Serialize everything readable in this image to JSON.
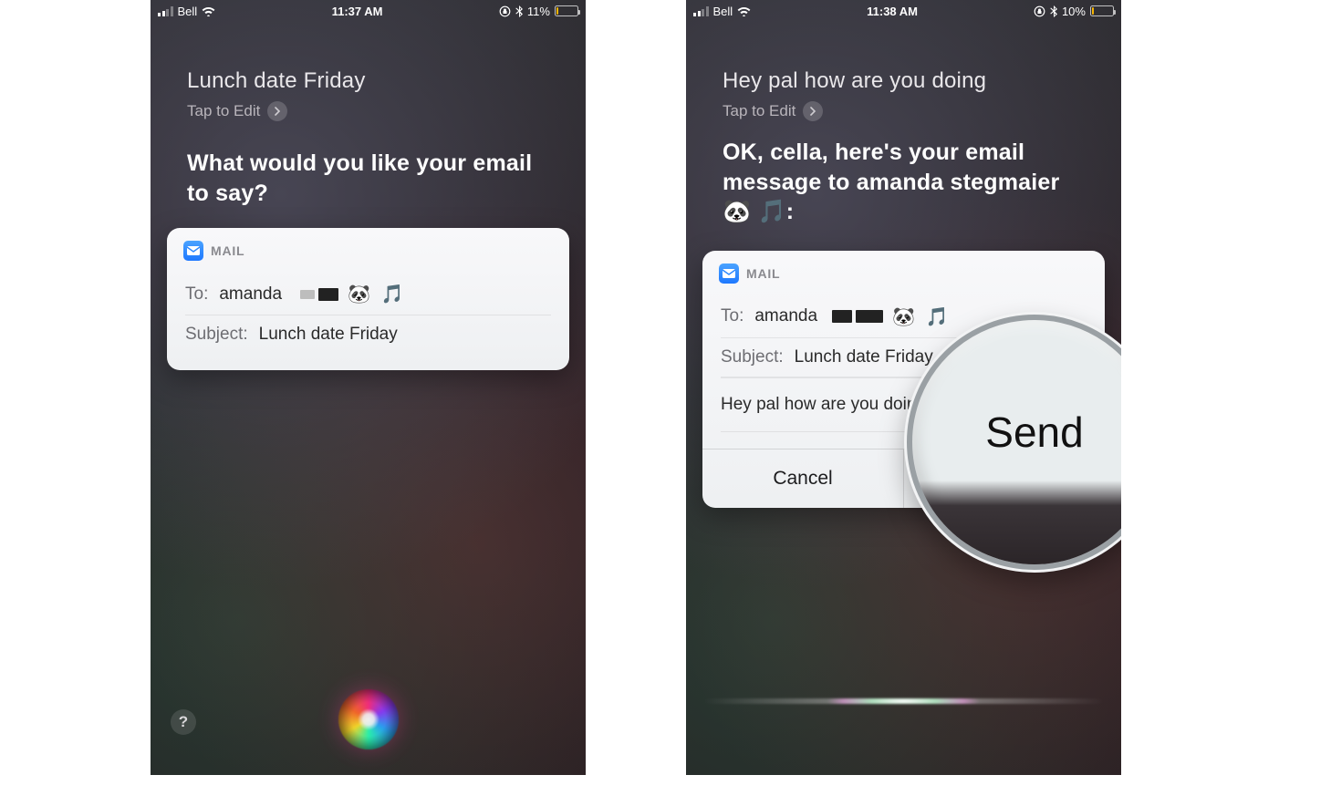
{
  "screens": [
    {
      "status": {
        "carrier": "Bell",
        "time": "11:37 AM",
        "battery_pct": "11%",
        "battery_level": 11
      },
      "user_said": "Lunch date Friday",
      "tap_edit": "Tap to Edit",
      "siri_reply": "What would you like your email to say?",
      "card": {
        "app_label": "MAIL",
        "to_label": "To:",
        "to_value": "amanda",
        "to_emoji": "🐼 🎵",
        "subject_label": "Subject:",
        "subject_value": "Lunch date Friday"
      }
    },
    {
      "status": {
        "carrier": "Bell",
        "time": "11:38 AM",
        "battery_pct": "10%",
        "battery_level": 10
      },
      "user_said": "Hey pal how are you doing",
      "tap_edit": "Tap to Edit",
      "siri_reply": "OK, cella, here's your email message to amanda stegmaier 🐼 🎵:",
      "card": {
        "app_label": "MAIL",
        "to_label": "To:",
        "to_value": "amanda",
        "to_emoji": "🐼 🎵",
        "subject_label": "Subject:",
        "subject_value": "Lunch date Friday",
        "body": "Hey pal how are you doing",
        "cancel": "Cancel",
        "send": "Send"
      },
      "magnify_label": "Send"
    }
  ]
}
